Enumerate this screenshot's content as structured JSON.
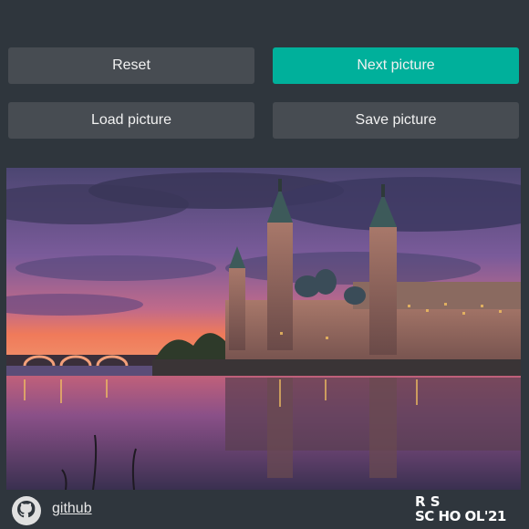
{
  "buttons": {
    "reset": "Reset",
    "next": "Next picture",
    "load": "Load picture",
    "save": "Save picture"
  },
  "colors": {
    "background": "#2f363d",
    "button": "#474c52",
    "accent": "#00b09b",
    "text": "#f1f1f1"
  },
  "image": {
    "icon": "photo-cathedral-at-dusk"
  },
  "footer": {
    "github_label": "github",
    "github_icon": "github-icon",
    "logo_line1": "R  S",
    "logo_line2": "SC HO OL'21",
    "logo_icon": "rs-school-logo"
  }
}
